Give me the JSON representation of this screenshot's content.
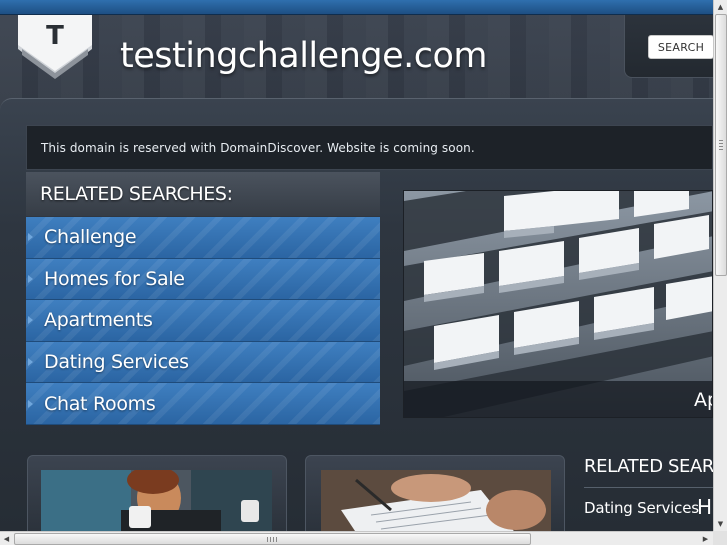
{
  "site": {
    "logo_letter": "T",
    "title": "testingchallenge.com"
  },
  "search": {
    "label": "SEARCH"
  },
  "notice": {
    "text": "This domain is reserved with DomainDiscover. Website is coming soon."
  },
  "related_searches": {
    "title": "RELATED SEARCHES:",
    "items": [
      {
        "label": "Challenge"
      },
      {
        "label": "Homes for Sale"
      },
      {
        "label": "Apartments"
      },
      {
        "label": "Dating Services"
      },
      {
        "label": "Chat Rooms"
      }
    ]
  },
  "feature": {
    "caption": "Ap"
  },
  "bottom_related": {
    "title": "RELATED SEAR",
    "item": "Dating Services",
    "item_partial": "H"
  },
  "colors": {
    "accent_blue": "#3f7fc0",
    "top_strip": "#2f6fae",
    "panel_dark": "#1d2228"
  }
}
